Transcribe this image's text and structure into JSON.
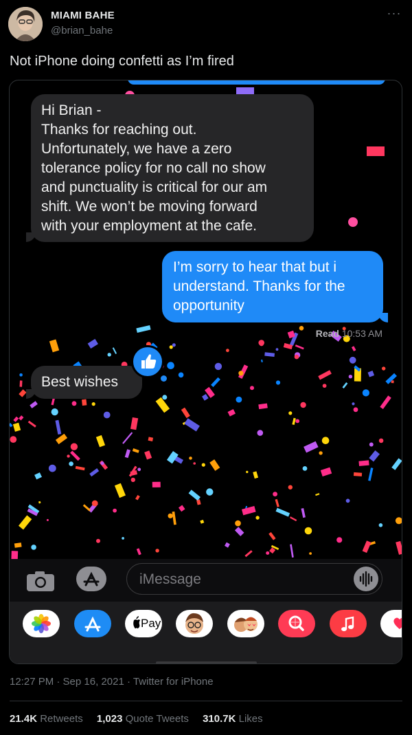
{
  "author": {
    "display_name": "MIAMI BAHE",
    "handle": "@brian_bahe",
    "more_label": "···"
  },
  "tweet": {
    "text": "Not iPhone doing confetti as I’m fired",
    "timestamp": "12:27 PM · Sep 16, 2021 · Twitter for iPhone"
  },
  "conversation": {
    "received_message_lines": [
      "Hi Brian -",
      "Thanks for reaching out.",
      "Unfortunately, we have a zero",
      "tolerance policy for no call no show",
      "and punctuality is critical for our am",
      "shift.  We won’t be moving forward",
      "with your employment at the cafe."
    ],
    "sent_message_lines": [
      "I’m sorry to hear that but i",
      "understand. Thanks for the",
      "opportunity"
    ],
    "read_label": "Read",
    "read_time": "10:53 AM",
    "reply_message": "Best wishes",
    "tapback_icon": "thumbs-up-icon",
    "input_placeholder": "iMessage"
  },
  "app_drawer": {
    "items": [
      "Photos",
      "App Store",
      "Apple Pay",
      "Memoji",
      "Memoji Stickers",
      "Search",
      "Music",
      "Digital Touch"
    ],
    "apple_pay_label": "Pay"
  },
  "stats": {
    "retweets_count": "21.4K",
    "retweets_label": "Retweets",
    "quote_count": "1,023",
    "quote_label": "Quote Tweets",
    "likes_count": "310.7K",
    "likes_label": "Likes"
  },
  "colors": {
    "sent_bubble": "#1f8af7",
    "received_bubble": "#262628",
    "background": "#000000",
    "secondary_text": "#71767b"
  }
}
